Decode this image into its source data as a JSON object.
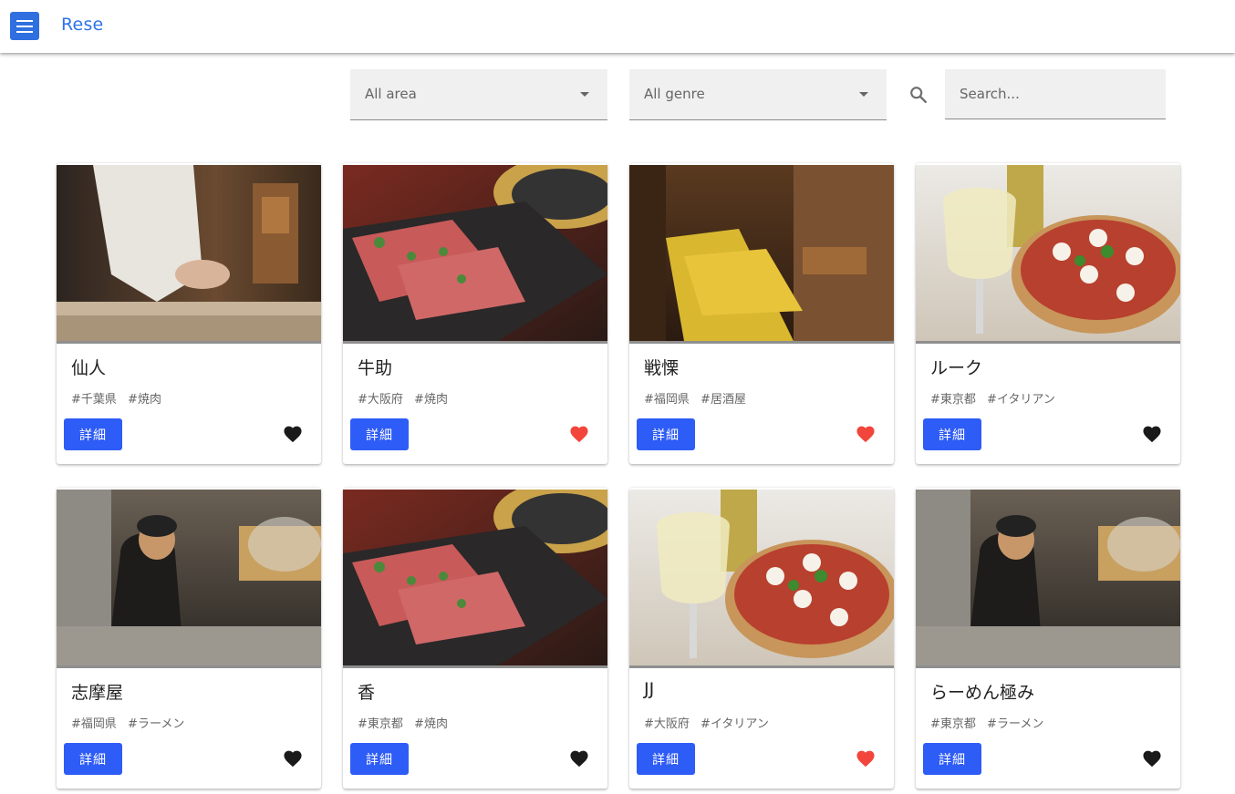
{
  "header": {
    "brand": "Rese",
    "menu_icon": "menu-icon"
  },
  "filters": {
    "area_selected": "All area",
    "genre_selected": "All genre",
    "search_placeholder": "Search...",
    "search_icon": "search-icon"
  },
  "colors": {
    "brand_text": "#2f74e6",
    "menu_button": "#2f6fe0",
    "detail_button": "#2e5cf6",
    "favorite_on": "#f2453b",
    "favorite_off": "#1a1a1a"
  },
  "shops": [
    {
      "name": "仙人",
      "area": "#千葉県",
      "genre": "#焼肉",
      "detail_label": "詳細",
      "favorite": false,
      "photo": "sushi-chef-photo"
    },
    {
      "name": "牛助",
      "area": "#大阪府",
      "genre": "#焼肉",
      "detail_label": "詳細",
      "favorite": true,
      "photo": "yakiniku-beef-photo"
    },
    {
      "name": "戦慄",
      "area": "#福岡県",
      "genre": "#居酒屋",
      "detail_label": "詳細",
      "favorite": true,
      "photo": "izakaya-interior-photo"
    },
    {
      "name": "ルーク",
      "area": "#東京都",
      "genre": "#イタリアン",
      "detail_label": "詳細",
      "favorite": false,
      "photo": "pizza-wine-photo"
    },
    {
      "name": "志摩屋",
      "area": "#福岡県",
      "genre": "#ラーメン",
      "detail_label": "詳細",
      "favorite": false,
      "photo": "ramen-chef-kitchen-photo"
    },
    {
      "name": "香",
      "area": "#東京都",
      "genre": "#焼肉",
      "detail_label": "詳細",
      "favorite": false,
      "photo": "yakiniku-beef-photo"
    },
    {
      "name": "JJ",
      "area": "#大阪府",
      "genre": "#イタリアン",
      "detail_label": "詳細",
      "favorite": true,
      "photo": "pizza-wine-photo"
    },
    {
      "name": "らーめん極み",
      "area": "#東京都",
      "genre": "#ラーメン",
      "detail_label": "詳細",
      "favorite": false,
      "photo": "ramen-chef-kitchen-photo"
    }
  ]
}
